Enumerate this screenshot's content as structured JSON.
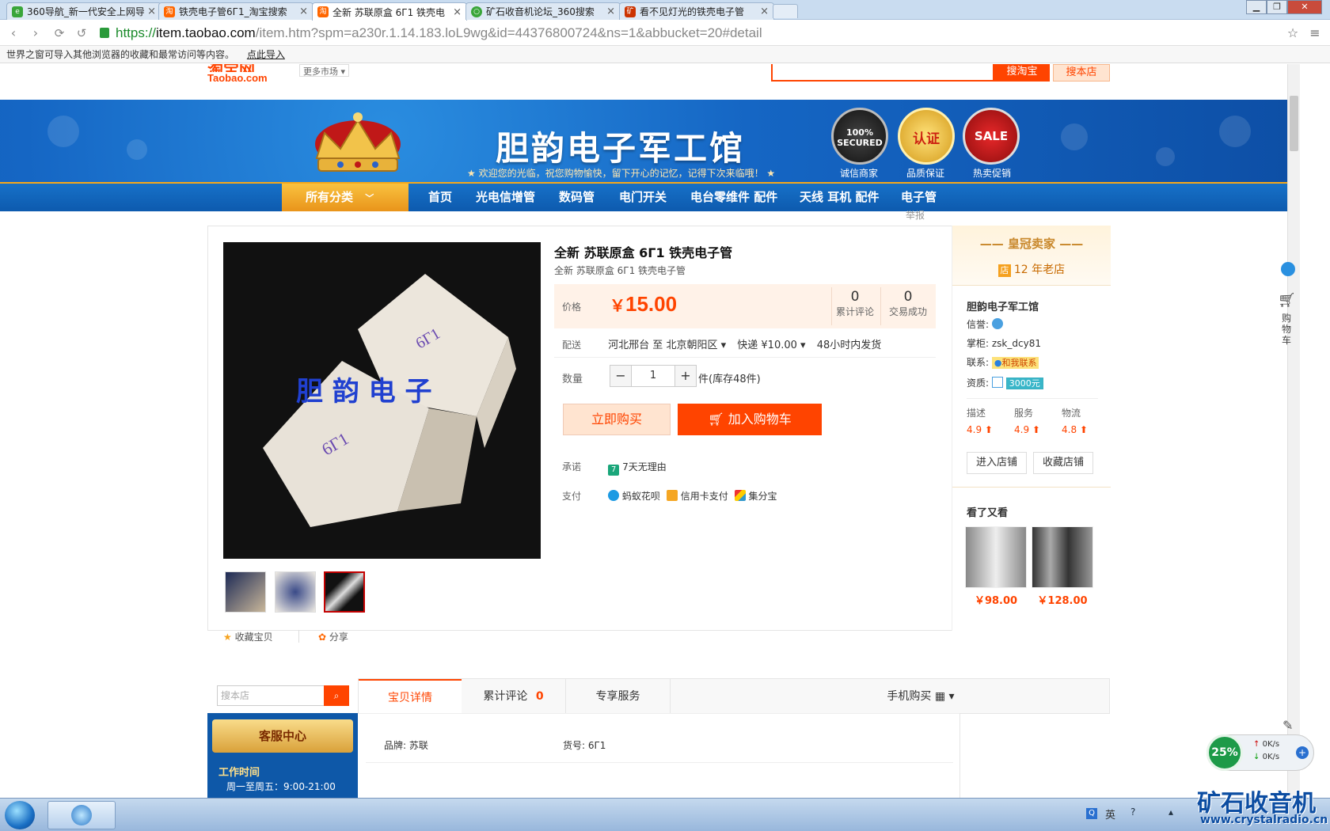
{
  "browser": {
    "tabs": [
      {
        "title": "360导航_新一代安全上网导",
        "active": false
      },
      {
        "title": "铁壳电子管6Г1_淘宝搜索",
        "active": false
      },
      {
        "title": "全新 苏联原盒 6Г1 铁壳电",
        "active": true
      },
      {
        "title": "矿石收音机论坛_360搜索",
        "active": false
      },
      {
        "title": "看不见灯光的铁壳电子管",
        "active": false
      }
    ],
    "close_glyph": "×",
    "url_scheme": "https://",
    "url_host": "item.taobao.com",
    "url_path": "/item.htm?spm=a230r.1.14.183.loL9wg&id=44376800724&ns=1&abbucket=20#detail",
    "import_msg": "世界之窗可导入其他浏览器的收藏和最常访问等内容。",
    "import_link": "点此导入"
  },
  "site": {
    "logo_text": "Taobao.com",
    "market": "更多市场",
    "search_taobao": "搜淘宝",
    "search_store": "搜本店"
  },
  "banner": {
    "title": "胆韵电子军工馆",
    "subtitle": "欢迎您的光临，祝您购物愉快，留下开心的记忆，记得下次来临哦！",
    "badges": [
      {
        "text": "100% SECURED",
        "label": "诚信商家"
      },
      {
        "text": "认证",
        "label": "品质保证"
      },
      {
        "text": "SALE",
        "label": "热卖促销"
      }
    ]
  },
  "nav": {
    "all_categories": "所有分类",
    "items": [
      "首页",
      "光电信增管",
      "数码管",
      "电门开关",
      "电台零维件 配件",
      "天线 耳机 配件",
      "电子管"
    ]
  },
  "product": {
    "report": "举报",
    "title": "全新 苏联原盒 6Г1 铁壳电子管",
    "subtitle": "全新 苏联原盒 6Г1 铁壳电子管",
    "image_overlay": "胆 韵 电 子",
    "box_label": "6Г1",
    "price_label": "价格",
    "currency": "￥",
    "price": "15.00",
    "reviews_count": "0",
    "reviews_label": "累计评论",
    "deals_count": "0",
    "deals_label": "交易成功",
    "shipping_label": "配送",
    "shipping_from": "河北邢台 至",
    "shipping_to": "北京朝阳区",
    "shipping_method": "快递 ¥10.00",
    "shipping_time": "48小时内发货",
    "qty_label": "数量",
    "qty_value": "1",
    "qty_minus": "−",
    "qty_plus": "+",
    "stock": "件(库存48件)",
    "buy_now": "立即购买",
    "add_cart": "加入购物车",
    "promise_label": "承诺",
    "promise_icon_text": "7",
    "promise": "7天无理由",
    "pay_label": "支付",
    "pay_methods": [
      "蚂蚁花呗",
      "信用卡支付",
      "集分宝"
    ],
    "fav": "收藏宝贝",
    "share": "分享"
  },
  "seller": {
    "crown": "皇冠卖家",
    "years": "12 年老店",
    "shop_icon_text": "店",
    "name": "胆韵电子军工馆",
    "credit_label": "信誉:",
    "owner_label": "掌柜:",
    "owner": "zsk_dcy81",
    "contact_label": "联系:",
    "contact_btn": "和我联系",
    "qual_label": "资质:",
    "qual_badge": "3000元",
    "scores": [
      {
        "label": "描述",
        "value": "4.9"
      },
      {
        "label": "服务",
        "value": "4.9"
      },
      {
        "label": "物流",
        "value": "4.8"
      }
    ],
    "enter_store": "进入店铺",
    "fav_store": "收藏店铺",
    "also_viewed": "看了又看",
    "recs": [
      {
        "price": "￥98.00"
      },
      {
        "price": "￥128.00"
      }
    ]
  },
  "lower": {
    "search_placeholder": "搜本店",
    "service_title": "客服中心",
    "work_time": "工作时间",
    "work_hours": "周一至周五：9:00-21:00",
    "tabs": [
      "宝贝详情",
      "累计评论",
      "专享服务"
    ],
    "review_count": "0",
    "mobile_buy": "手机购买",
    "brand": "品牌: 苏联",
    "sku": "货号: 6Г1"
  },
  "right_sidebar": {
    "cart": "购物车"
  },
  "overlay": {
    "speed_pct": "25%",
    "up": "0K/s",
    "down": "0K/s",
    "watermark": "矿石收音机",
    "watermark_url": "www.crystalradio.cn"
  },
  "taskbar": {
    "lang": "英"
  },
  "colors": {
    "accent": "#ff4400",
    "banner_blue": "#1566c4",
    "nav_gold": "#f7a818"
  }
}
